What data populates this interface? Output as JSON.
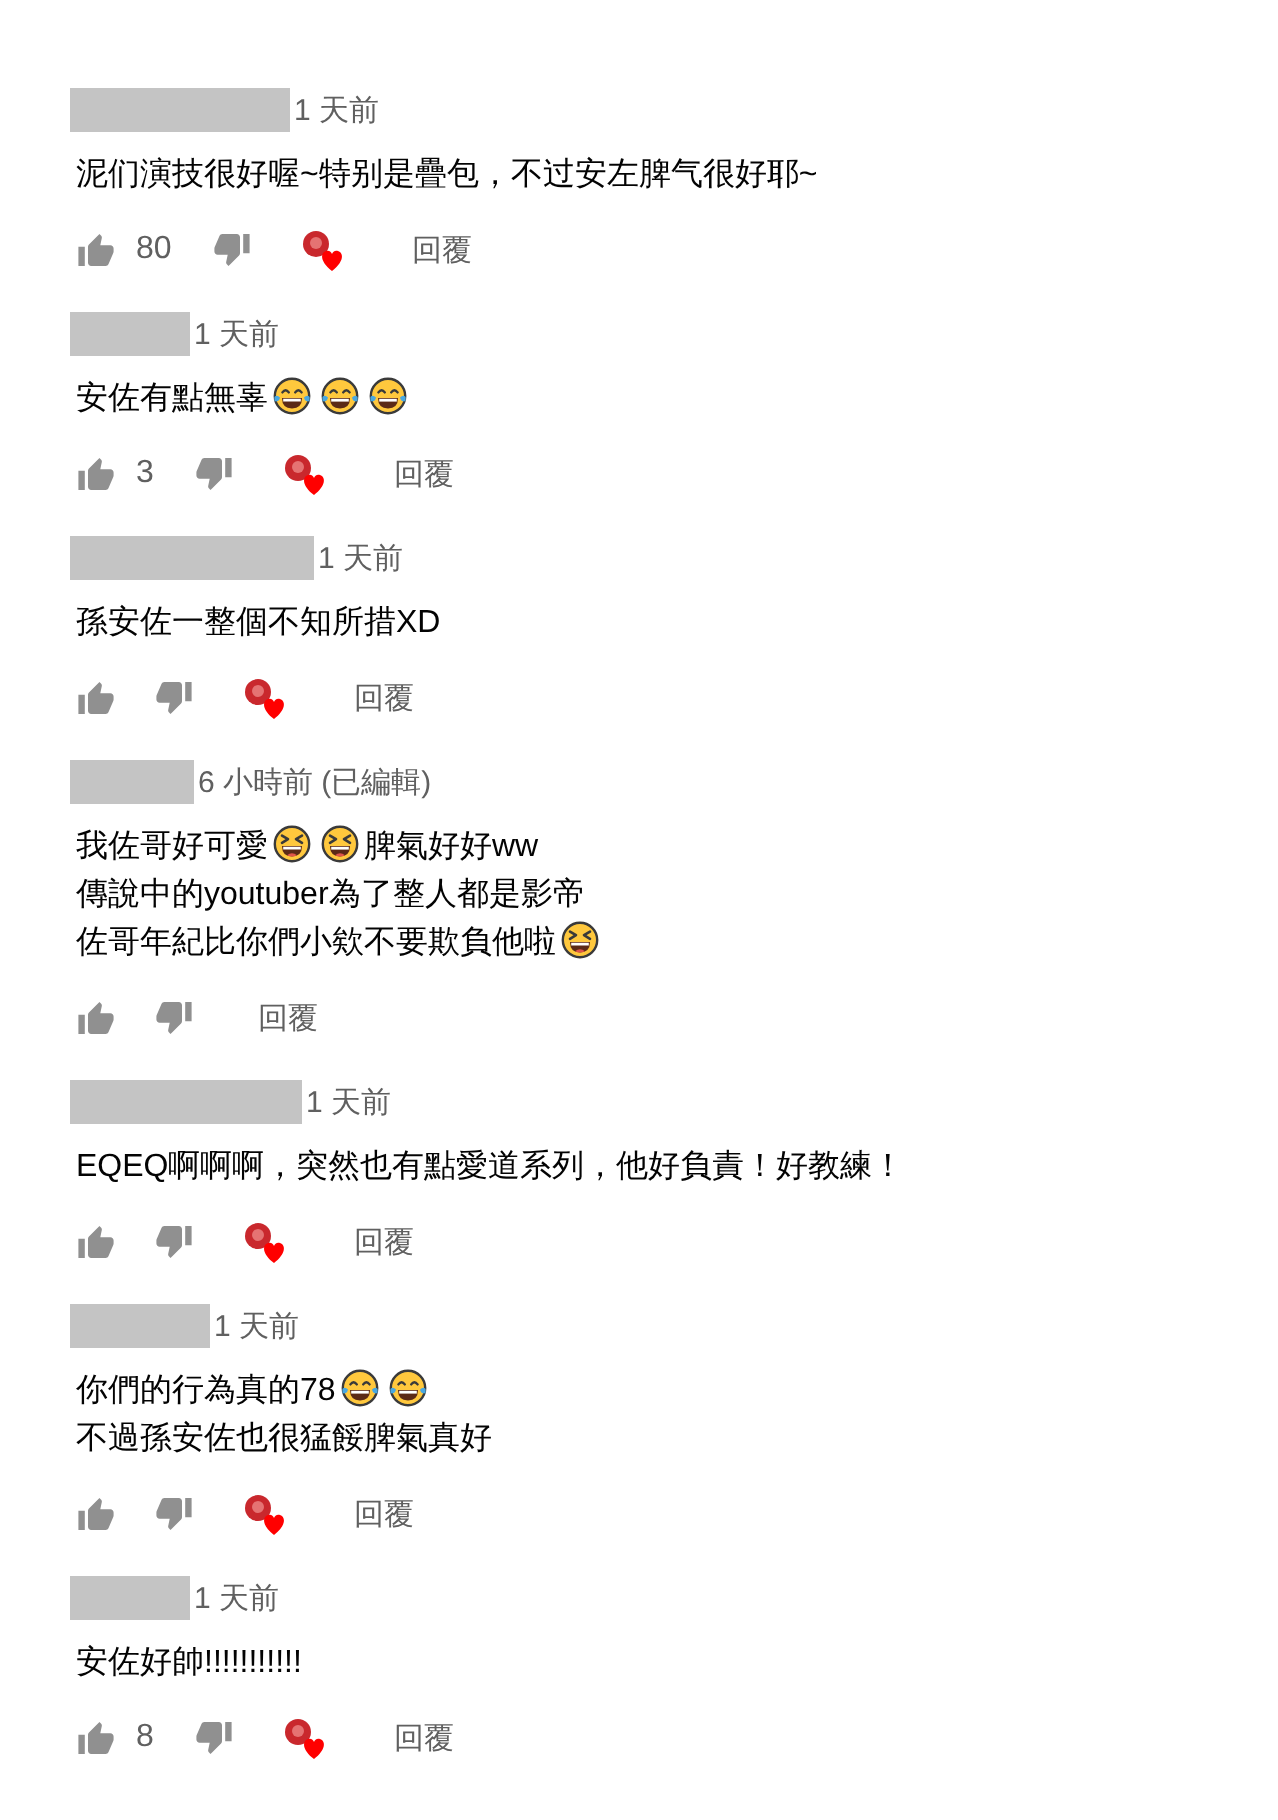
{
  "comments": [
    {
      "author_redacted": true,
      "time": "1 天前",
      "lines": [
        [
          {
            "kind": "text",
            "text": "泥们演技很好喔~特别是疊包，不过安左脾气很好耶~"
          }
        ]
      ],
      "likes": "80",
      "hearted": true,
      "reply": "回覆"
    },
    {
      "author_redacted": true,
      "time": "1 天前",
      "lines": [
        [
          {
            "kind": "text",
            "text": "安佐有點無辜"
          },
          {
            "kind": "tears_of_joy"
          },
          {
            "kind": "tears_of_joy"
          },
          {
            "kind": "tears_of_joy"
          }
        ]
      ],
      "likes": "3",
      "hearted": true,
      "reply": "回覆"
    },
    {
      "author_redacted": true,
      "time": "1 天前",
      "lines": [
        [
          {
            "kind": "text",
            "text": "孫安佐一整個不知所措XD"
          }
        ]
      ],
      "hearted": true,
      "reply": "回覆"
    },
    {
      "author_redacted": true,
      "time": "6 小時前 (已編輯)",
      "lines": [
        [
          {
            "kind": "text",
            "text": "我佐哥好可愛"
          },
          {
            "kind": "squinting_laugh"
          },
          {
            "kind": "squinting_laugh"
          },
          {
            "kind": "text",
            "text": "脾氣好好ww"
          }
        ],
        [
          {
            "kind": "text",
            "text": "傳說中的youtuber為了整人都是影帝"
          }
        ],
        [
          {
            "kind": "text",
            "text": "佐哥年紀比你們小欸不要欺負他啦"
          },
          {
            "kind": "squinting_laugh"
          }
        ]
      ],
      "hearted": false,
      "reply": "回覆"
    },
    {
      "author_redacted": true,
      "time": "1 天前",
      "lines": [
        [
          {
            "kind": "text",
            "text": "EQEQ啊啊啊，突然也有點愛道系列，他好負責！好教練！"
          }
        ]
      ],
      "hearted": true,
      "reply": "回覆"
    },
    {
      "author_redacted": true,
      "time": "1 天前",
      "lines": [
        [
          {
            "kind": "text",
            "text": "你們的行為真的78"
          },
          {
            "kind": "tears_of_joy"
          },
          {
            "kind": "tears_of_joy"
          }
        ],
        [
          {
            "kind": "text",
            "text": "不過孫安佐也很猛餒脾氣真好"
          }
        ]
      ],
      "hearted": true,
      "reply": "回覆"
    },
    {
      "author_redacted": true,
      "time": "1 天前",
      "lines": [
        [
          {
            "kind": "text",
            "text": "安佐好帥!!!!!!!!!!!"
          }
        ]
      ],
      "likes": "8",
      "hearted": true,
      "reply": "回覆"
    }
  ]
}
